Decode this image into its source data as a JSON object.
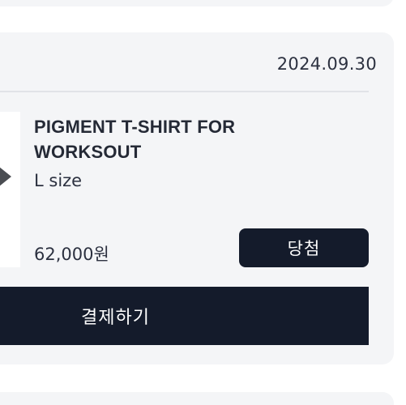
{
  "order": {
    "date": "2024.09.30",
    "product_name": "PIGMENT T-SHIRT FOR WORKSOUT",
    "option": "L size",
    "price": "62,000원",
    "status": "당첨"
  },
  "actions": {
    "pay_label": "결제하기"
  },
  "colors": {
    "card_background": "#f4f5f7",
    "button_background": "#141b2b",
    "button_text": "#ffffff"
  },
  "icons": {
    "thumbnail_arrow": "arrow-right-icon"
  }
}
